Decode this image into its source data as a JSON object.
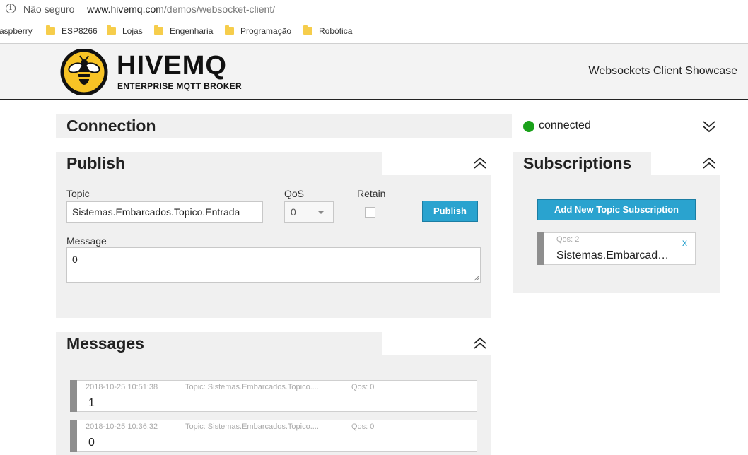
{
  "browser": {
    "security": "Não seguro",
    "url_host": "www.hivemq.com",
    "url_path": "/demos/websocket-client/",
    "bookmarks": [
      "aspberry",
      "ESP8266",
      "Lojas",
      "Engenharia",
      "Programação",
      "Robótica"
    ]
  },
  "header": {
    "brand": "HIVEMQ",
    "tagline": "ENTERPRISE MQTT BROKER",
    "showcase": "Websockets Client Showcase"
  },
  "connection": {
    "title": "Connection",
    "status": "connected",
    "status_color": "#1aa11a"
  },
  "publish": {
    "title": "Publish",
    "topic_label": "Topic",
    "topic_value": "Sistemas.Embarcados.Topico.Entrada",
    "qos_label": "QoS",
    "qos_value": "0",
    "retain_label": "Retain",
    "button_label": "Publish",
    "message_label": "Message",
    "message_value": "0"
  },
  "subscriptions": {
    "title": "Subscriptions",
    "add_button": "Add New Topic Subscription",
    "items": [
      {
        "qos": "Qos: 2",
        "topic": "Sistemas.Embarcad…",
        "close": "x"
      }
    ]
  },
  "messages": {
    "title": "Messages",
    "items": [
      {
        "timestamp": "2018-10-25 10:51:38",
        "topic": "Topic: Sistemas.Embarcados.Topico....",
        "qos": "Qos: 0",
        "payload": "1"
      },
      {
        "timestamp": "2018-10-25 10:36:32",
        "topic": "Topic: Sistemas.Embarcados.Topico....",
        "qos": "Qos: 0",
        "payload": "0"
      }
    ]
  },
  "colors": {
    "accent": "#2aa3cf",
    "panel": "#f0f0f0",
    "logo_yellow": "#f7c325"
  }
}
